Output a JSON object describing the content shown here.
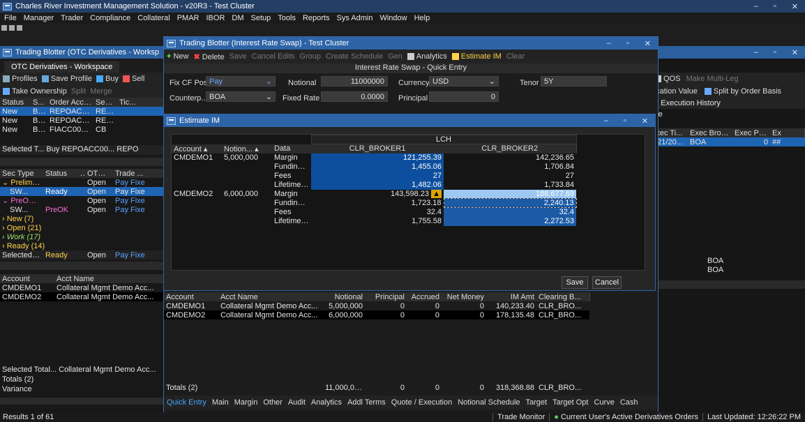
{
  "main_title": "Charles River Investment Management Solution - v20R3 - Test Cluster",
  "menu": [
    "File",
    "Manager",
    "Trader",
    "Compliance",
    "Collateral",
    "PMAR",
    "IBOR",
    "DM",
    "Setup",
    "Tools",
    "Reports",
    "Sys Admin",
    "Window",
    "Help"
  ],
  "otc": {
    "title": "Trading Blotter (OTC Derivatives - Worksp",
    "workspace_tab": "OTC Derivatives - Workspace",
    "toolbar1": [
      "Profiles",
      "Save Profile",
      "Buy",
      "Sell"
    ],
    "toolbar2": [
      "Take Ownership",
      "Split",
      "Merge"
    ],
    "cols": [
      "Status",
      "S...",
      "Order Acco...",
      "Sec ...",
      "Tic..."
    ],
    "rows": [
      [
        "New",
        "Buy",
        "REPOACC00...",
        "REPO"
      ],
      [
        "New",
        "Buy",
        "REPOACC00...",
        "REPO"
      ],
      [
        "New",
        "Buy",
        "FIACC00120",
        "CB"
      ]
    ],
    "selected1": "Selected T...  Buy  REPOACC00...  REPO",
    "cols2": [
      "Sec Type",
      "Status",
      "...",
      "OTC TT",
      "Trade ..."
    ],
    "groups": [
      {
        "label": "Prelim (1)",
        "status": "Open",
        "tt": "Pay Fixe"
      },
      {
        "sub": "SW...",
        "subStatus": "Ready",
        "status": "Open",
        "tt": "Pay Fixe"
      },
      {
        "label": "PreOK (1)",
        "status": "Open",
        "tt": "Pay Fixe"
      },
      {
        "sub": "SW...",
        "subStatus": "PreOK",
        "status": "Open",
        "tt": "Pay Fixe"
      },
      {
        "label": "New (7)"
      },
      {
        "label": "Open (21)"
      },
      {
        "label": "Work (17)"
      },
      {
        "label": "Ready (14)"
      }
    ],
    "selected2": [
      "Selected Tota...",
      "Ready",
      "Open",
      "Pay Fixe"
    ]
  },
  "bottom_left": {
    "cols": [
      "Account",
      "Acct Name"
    ],
    "rows": [
      [
        "CMDEMO1",
        "Collateral Mgmt Demo Acc..."
      ],
      [
        "CMDEMO2",
        "Collateral Mgmt Demo Acc..."
      ]
    ],
    "selected": "Selected Total...  Collateral Mgmt Demo Acc...",
    "totals": "Totals (2)",
    "variance": "Variance"
  },
  "right_panel": {
    "toolbar": [
      "QOS",
      "Make Multi-Leg"
    ],
    "toolbar2": [
      "ocation Value",
      "Split by Order Basis"
    ],
    "history": "ap Execution History",
    "eve": "eve",
    "cols": [
      "Exec Ti...",
      "Exec Broker",
      "Exec Price",
      "Ex"
    ],
    "row": [
      "8/21/20...",
      "BOA",
      "0",
      "##"
    ],
    "boa": [
      "BOA",
      "BOA"
    ]
  },
  "irs": {
    "title": "Trading Blotter (Interest Rate Swap) - Test Cluster",
    "toolbar": [
      "New",
      "Delete",
      "Save",
      "Cancel Edits",
      "Group",
      "Create Schedule",
      "Gen",
      "Analytics",
      "Estimate IM",
      "Clear"
    ],
    "header": "Interest Rate Swap - Quick Entry",
    "fix_cf_pos": "Fix CF Pos",
    "fix_cf_val": "Pay",
    "notional_lbl": "Notional",
    "notional_val": "11000000",
    "currency_lbl": "Currency",
    "currency_val": "USD",
    "tenor_lbl": "Tenor",
    "tenor_val": "5Y",
    "cp_lbl": "Counterp...",
    "cp_val": "BOA",
    "fixed_lbl": "Fixed Rate",
    "fixed_val": "0.0000",
    "principal_lbl": "Principal",
    "principal_val": "0",
    "grid_cols": [
      "Account",
      "Acct Name",
      "Notional",
      "Principal",
      "Accrued",
      "Net Money",
      "IM Amt",
      "Clearing B..."
    ],
    "grid_rows": [
      [
        "CMDEMO1",
        "Collateral Mgmt Demo Acc...",
        "5,000,000",
        "0",
        "0",
        "0",
        "140,233.40",
        "CLR_BRO..."
      ],
      [
        "CMDEMO2",
        "Collateral Mgmt Demo Acc...",
        "6,000,000",
        "0",
        "0",
        "0",
        "178,135.48",
        "CLR_BRO..."
      ]
    ],
    "totals": [
      "Totals (2)",
      "11,000,000",
      "0",
      "0",
      "0",
      "318,368.88",
      "CLR_BRO..."
    ],
    "tabs": [
      "Quick Entry",
      "Main",
      "Margin",
      "Other",
      "Audit",
      "Analytics",
      "Addl Terms",
      "Quote / Execution",
      "Notional Schedule",
      "Target",
      "Target Opt",
      "Curve",
      "Cash"
    ]
  },
  "estimate": {
    "title": "Estimate IM",
    "group": "LCH",
    "cols": [
      "Account",
      "Notion...",
      "Data",
      "CLR_BROKER1",
      "CLR_BROKER2"
    ],
    "rows": [
      {
        "acct": "CMDEMO1",
        "notional": "5,000,000",
        "data": "Margin",
        "b1": "121,255.39",
        "b2": "142,236.65"
      },
      {
        "data": "Funding C...",
        "b1": "1,455.06",
        "b2": "1,706.84"
      },
      {
        "data": "Fees",
        "b1": "27",
        "b2": "27"
      },
      {
        "data": "Lifetime C...",
        "b1": "1,482.06",
        "b2": "1,733.84"
      },
      {
        "acct": "CMDEMO2",
        "notional": "6,000,000",
        "data": "Margin",
        "b1": "143,598.23",
        "b2": "186,677.69"
      },
      {
        "data": "Funding C...",
        "b1": "1,723.18",
        "b2": "2,240.13"
      },
      {
        "data": "Fees",
        "b1": "32.4",
        "b2": "32.4"
      },
      {
        "data": "Lifetime C...",
        "b1": "1,755.58",
        "b2": "2,272.53"
      }
    ],
    "save": "Save",
    "cancel": "Cancel"
  },
  "status": {
    "results": "Results 1 of 61",
    "monitor": "Trade Monitor",
    "orders": "Current User's Active Derivatives Orders",
    "updated": "Last Updated: 12:26:22 PM"
  }
}
